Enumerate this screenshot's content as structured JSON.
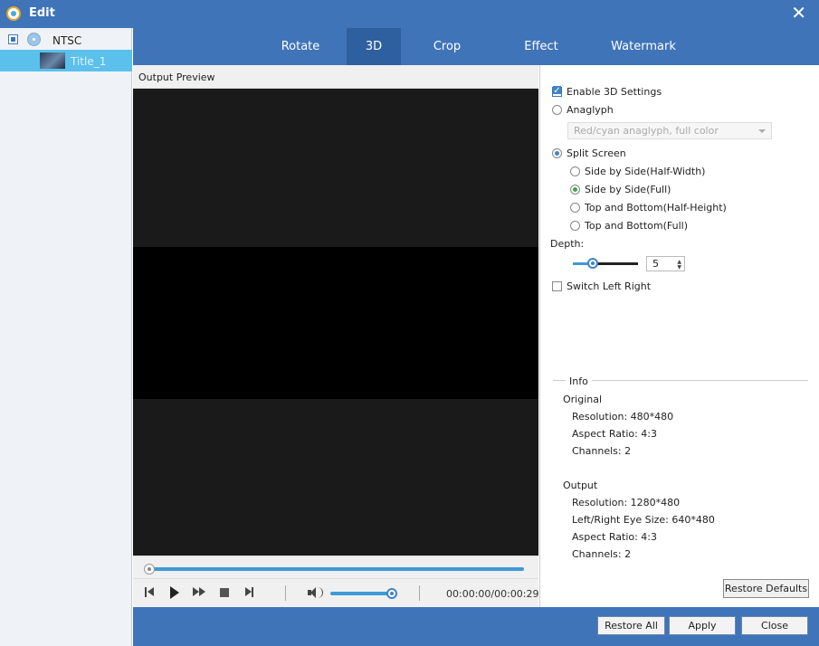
{
  "window": {
    "title": "Edit",
    "close_glyph": "✕"
  },
  "sidebar": {
    "items": [
      {
        "label": "NTSC",
        "icon": "disc-icon"
      },
      {
        "label": "Title_1",
        "icon": "video-thumbnail"
      }
    ]
  },
  "tabs": [
    {
      "label": "Rotate",
      "active": false
    },
    {
      "label": "3D",
      "active": true
    },
    {
      "label": "Crop",
      "active": false
    },
    {
      "label": "Effect",
      "active": false
    },
    {
      "label": "Watermark",
      "active": false
    }
  ],
  "preview": {
    "label": "Output Preview",
    "time": "00:00:00/00:00:29"
  },
  "settings": {
    "enable_3d": {
      "label": "Enable 3D Settings",
      "checked": true
    },
    "anaglyph": {
      "label": "Anaglyph",
      "selected": false
    },
    "anaglyph_select": "Red/cyan anaglyph, full color",
    "split_screen": {
      "label": "Split Screen",
      "selected": true
    },
    "split_options": [
      {
        "label": "Side by Side(Half-Width)",
        "selected": false
      },
      {
        "label": "Side by Side(Full)",
        "selected": true
      },
      {
        "label": "Top and Bottom(Half-Height)",
        "selected": false
      },
      {
        "label": "Top and Bottom(Full)",
        "selected": false
      }
    ],
    "depth_label": "Depth:",
    "depth_value": "5",
    "switch_lr": {
      "label": "Switch Left Right",
      "checked": false
    }
  },
  "info": {
    "title": "Info",
    "original_title": "Original",
    "original": {
      "resolution": "Resolution: 480*480",
      "aspect": "Aspect Ratio: 4:3",
      "channels": "Channels: 2"
    },
    "output_title": "Output",
    "output": {
      "resolution": "Resolution: 1280*480",
      "eye_size": "Left/Right Eye Size: 640*480",
      "aspect": "Aspect Ratio: 4:3",
      "channels": "Channels: 2"
    }
  },
  "buttons": {
    "restore_defaults": "Restore Defaults",
    "restore_all": "Restore All",
    "apply": "Apply",
    "close": "Close"
  },
  "colors": {
    "titlebar": "#3f74b9",
    "active_tab": "#2e5f9f",
    "selected_item": "#5bc0eb",
    "accent": "#3f84c7"
  }
}
